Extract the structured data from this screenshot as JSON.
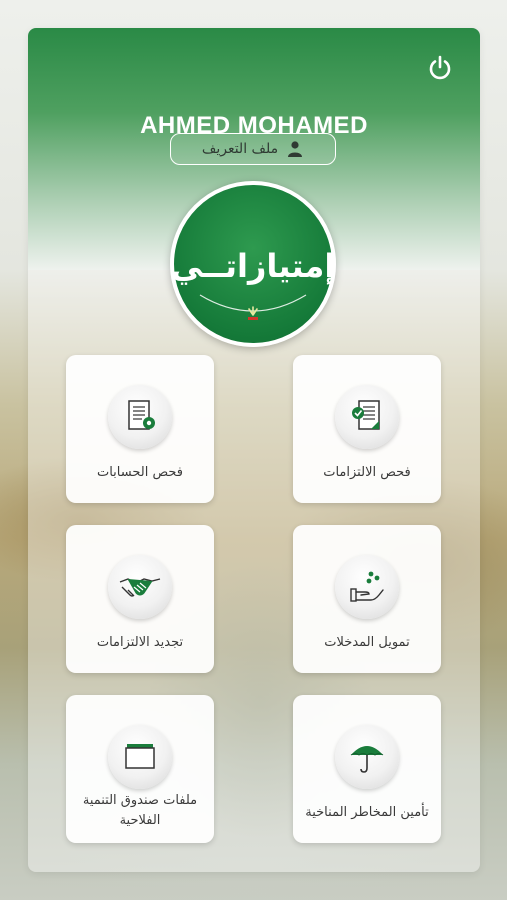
{
  "user": {
    "name": "AHMED MOHAMED"
  },
  "profile_button": {
    "label": "ملف التعريف",
    "icon": "user-icon"
  },
  "logo": {
    "text": "إمتيازاتــي"
  },
  "power_icon": "power-icon",
  "colors": {
    "brand_green": "#1a7d3c",
    "accent_red": "#d0352b",
    "tile_bg": "#ffffff",
    "text_dark": "#3a3a3a"
  },
  "menu": [
    {
      "id": "check-obligations",
      "label": "فحص الالتزامات",
      "icon": "document-check-icon"
    },
    {
      "id": "check-accounts",
      "label": "فحص الحسابات",
      "icon": "document-gear-icon"
    },
    {
      "id": "input-financing",
      "label": "تمويل المدخلات",
      "icon": "hand-seeds-icon"
    },
    {
      "id": "renew-obligations",
      "label": "تجديد الالتزامات",
      "icon": "handshake-icon"
    },
    {
      "id": "climate-insurance",
      "label": "تأمين المخاطر المناخية",
      "icon": "umbrella-icon"
    },
    {
      "id": "fund-files",
      "label": "ملفات صندوق التنمية الفلاحية",
      "icon": "folder-icon"
    }
  ]
}
